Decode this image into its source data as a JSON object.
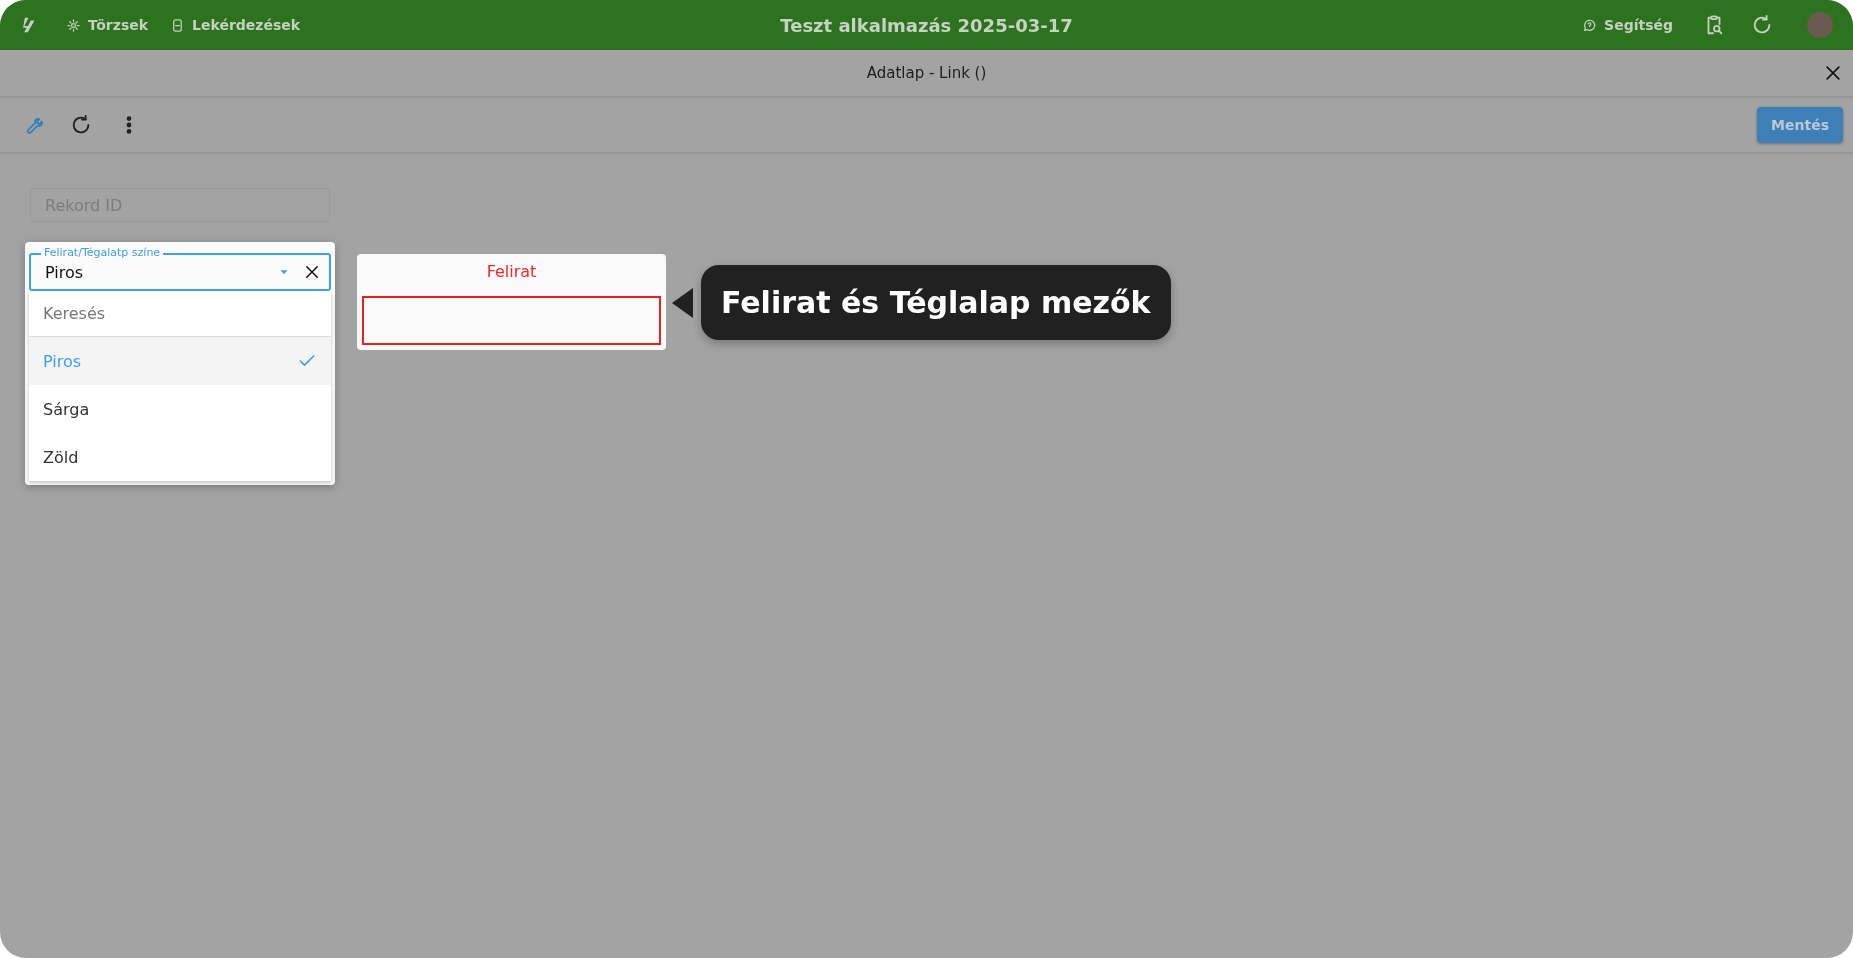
{
  "topbar": {
    "nav": [
      {
        "label": "Törzsek"
      },
      {
        "label": "Lekérdezések"
      }
    ],
    "title": "Teszt alkalmazás 2025-03-17",
    "help": "Segítség"
  },
  "dialog": {
    "title": "Adatlap - Link ()",
    "save": "Mentés"
  },
  "record_id": {
    "placeholder": "Rekord ID"
  },
  "color_select": {
    "label": "Felirat/Tégalatp színe",
    "value": "Piros",
    "search_placeholder": "Keresés",
    "options": [
      {
        "label": "Piros",
        "selected": true
      },
      {
        "label": "Sárga",
        "selected": false
      },
      {
        "label": "Zöld",
        "selected": false
      }
    ]
  },
  "preview": {
    "caption": "Felirat"
  },
  "tooltip": {
    "text": "Felirat és Téglalap mezők"
  }
}
